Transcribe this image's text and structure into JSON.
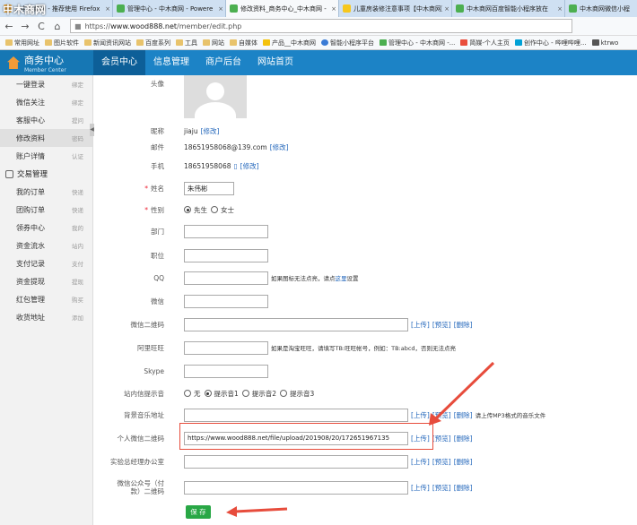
{
  "watermark": "中木商网",
  "tabs": [
    {
      "label": "…中木商网 - 推荐使用 Firefox",
      "active": false
    },
    {
      "label": "管理中心 - 中木商网 - Powere",
      "active": false
    },
    {
      "label": "修改资料_商务中心_中木商网 -",
      "active": true
    },
    {
      "label": "儿童房装修注意事项【中木商网】",
      "active": false
    },
    {
      "label": "中木商网百度智能小程序放在",
      "active": false
    },
    {
      "label": "中木商网微信小程",
      "active": false
    }
  ],
  "tab_close": "×",
  "nav": {
    "back": "←",
    "forward": "→",
    "reload": "C",
    "home": "⌂",
    "url_scheme": "https://",
    "url_host": "www.wood888.net",
    "url_path": "/member/edit.php"
  },
  "bookmarks": [
    "常用网址",
    "图片软件",
    "新闻资讯网站",
    "百度系列",
    "工具",
    "网站",
    "自媒体",
    "产品__中木商网",
    "智能小程序平台",
    "管理中心 - 中木商网 -...",
    "简媒-个人主页",
    "创作中心 - 哔哩哔哩...",
    "ktrwo"
  ],
  "header": {
    "logo_title": "商务中心",
    "logo_sub": "Member Center",
    "nav": [
      {
        "label": "会员中心",
        "active": true
      },
      {
        "label": "信息管理",
        "active": false
      },
      {
        "label": "商户后台",
        "active": false
      },
      {
        "label": "网站首页",
        "active": false
      }
    ]
  },
  "sidebar": {
    "items_top": [
      {
        "label": "一键登录",
        "sub": "绑定"
      },
      {
        "label": "微信关注",
        "sub": "绑定"
      },
      {
        "label": "客服中心",
        "sub": "提问"
      },
      {
        "label": "修改资料",
        "sub": "密码",
        "active": true
      },
      {
        "label": "账户详情",
        "sub": "认证"
      }
    ],
    "section_title": "交易管理",
    "items_bottom": [
      {
        "label": "我的订单",
        "sub": "快递"
      },
      {
        "label": "团购订单",
        "sub": "快递"
      },
      {
        "label": "领券中心",
        "sub": "我的"
      },
      {
        "label": "资金流水",
        "sub": "站内"
      },
      {
        "label": "支付记录",
        "sub": "支付"
      },
      {
        "label": "资金提现",
        "sub": "提现"
      },
      {
        "label": "红包管理",
        "sub": "购买"
      },
      {
        "label": "收货地址",
        "sub": "添加"
      }
    ],
    "toggle": "◀"
  },
  "form": {
    "avatar_label": "头像",
    "nickname_label": "昵称",
    "nickname_value": "jiaju",
    "edit_link": "[修改]",
    "email_label": "邮件",
    "email_value": "18651958068@139.com",
    "mobile_label": "手机",
    "mobile_value": "18651958068",
    "name_label": "姓名",
    "name_value": "朱伟彬",
    "gender_label": "性别",
    "gender_male": "先生",
    "gender_female": "女士",
    "dept_label": "部门",
    "position_label": "职位",
    "qq_label": "QQ",
    "qq_note": "如果图标无法点亮，请点",
    "qq_link": "这里",
    "qq_note2": "设置",
    "wechat_label": "微信",
    "wechat_qr_label": "微信二维码",
    "upload": "[上传]",
    "preview": "[预览]",
    "delete": "[删除]",
    "aliwang_label": "阿里旺旺",
    "aliwang_note": "如果是淘宝旺旺，请填写TB:旺旺帐号，例如：TB:abcd，否则无法点亮",
    "skype_label": "Skype",
    "tone_label": "站内信提示音",
    "tone_options": [
      "无",
      "提示音1",
      "提示音2",
      "提示音3"
    ],
    "bgm_label": "背景音乐地址",
    "bgm_note": "请上传MP3格式的音乐文件",
    "personal_qr_label": "个人微信二维码",
    "personal_qr_value": "https://www.wood888.net/file/upload/201908/20/172651967135",
    "manager_label": "实验总经理办公室",
    "public_qr_label_1": "微信公众号（付",
    "public_qr_label_2": "款）二维码",
    "save": "保 存"
  },
  "colors": {
    "header_blue": "#1c83c6",
    "active_nav": "#0d5f98",
    "save_green": "#28a745",
    "annotation_red": "#e74c3c"
  }
}
